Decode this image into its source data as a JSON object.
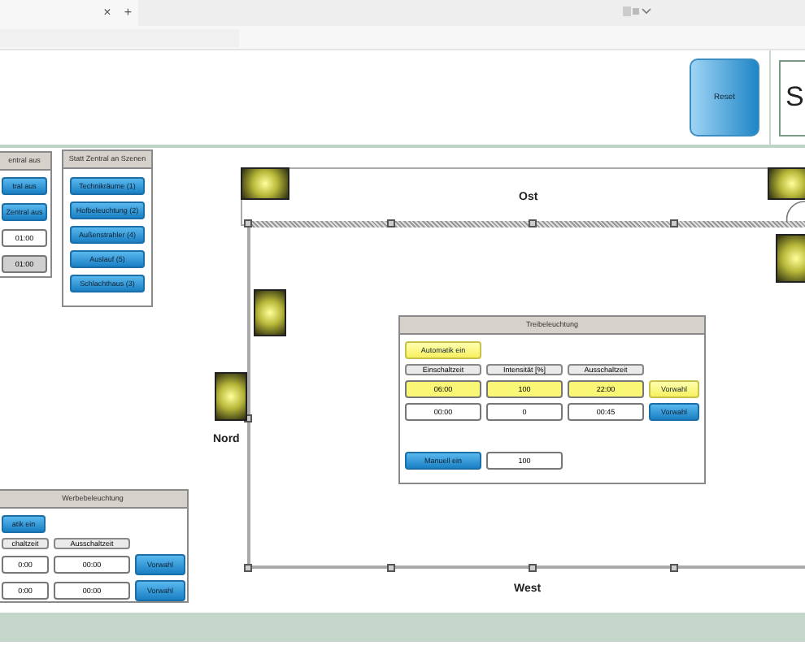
{
  "browser": {
    "tab_close": "×",
    "new_tab": "+"
  },
  "header": {
    "reset_button": "Reset",
    "corner_box": "S"
  },
  "zentral_aus": {
    "title": "entral aus",
    "buttons": [
      "tral aus",
      "Zentral aus"
    ],
    "fields": [
      {
        "value": "01:00",
        "disabled": false
      },
      {
        "value": "01:00",
        "disabled": true
      }
    ]
  },
  "szenen": {
    "title": "Statt Zentral an Szenen",
    "buttons": [
      "Technikräume (1)",
      "Hofbeleuchtung (2)",
      "Außenstrahler (4)",
      "Auslauf (5)",
      "Schlachthaus (3)"
    ]
  },
  "plan": {
    "top_label": "Ost",
    "left_label": "Nord",
    "bottom_label": "West"
  },
  "treibeleuchtung": {
    "title": "Treibeleuchtung",
    "automatik": {
      "label": "Automatik ein",
      "active": true
    },
    "columns": [
      "Einschaltzeit",
      "Intensität [%]",
      "Ausschaltzeit"
    ],
    "rows": [
      {
        "values": [
          "06:00",
          "100",
          "22:00"
        ],
        "button": "Vorwahl",
        "active": true
      },
      {
        "values": [
          "00:00",
          "0",
          "00:45"
        ],
        "button": "Vorwahl",
        "active": false
      }
    ],
    "manual": {
      "label": "Manuell ein",
      "active": false,
      "value": "100"
    }
  },
  "werbebeleuchtung": {
    "title": "Werbebeleuchtung",
    "automatik": {
      "label": "atik ein",
      "active": false
    },
    "columns": [
      "chaltzeit",
      "Ausschaltzeit"
    ],
    "rows": [
      {
        "values": [
          "0:00",
          "00:00"
        ],
        "button": "Vorwahl",
        "active": false
      },
      {
        "values": [
          "0:00",
          "00:00"
        ],
        "button": "Vorwahl",
        "active": false
      }
    ]
  }
}
